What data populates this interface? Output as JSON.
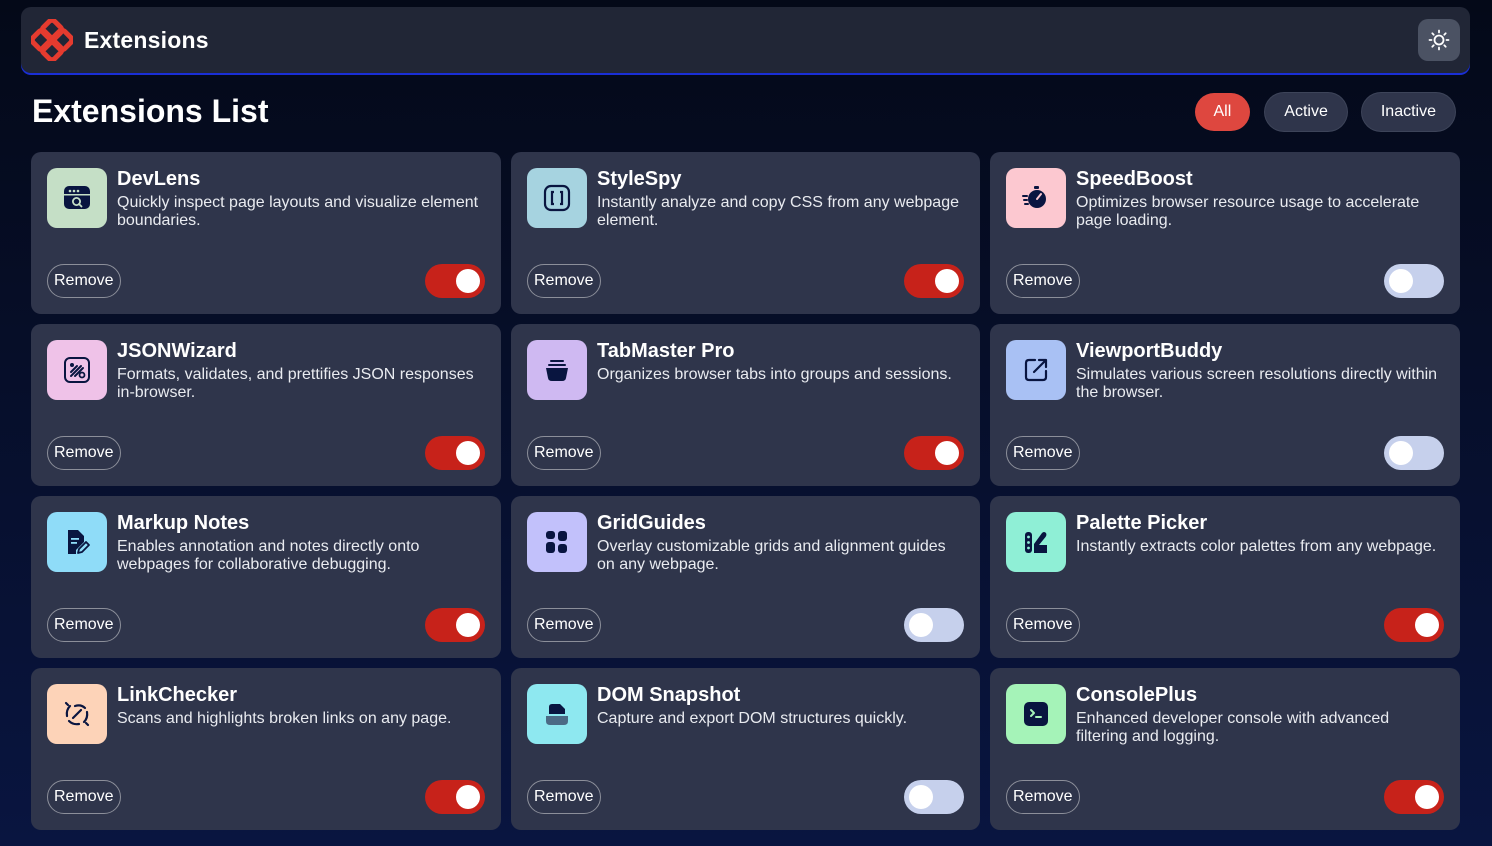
{
  "header": {
    "brand_name": "Extensions",
    "logo_icon": "logo-icon",
    "theme_icon": "sun-icon"
  },
  "page_title": "Extensions List",
  "filters": [
    {
      "label": "All",
      "selected": true
    },
    {
      "label": "Active",
      "selected": false
    },
    {
      "label": "Inactive",
      "selected": false
    }
  ],
  "colors": {
    "accent": "#de473f",
    "toggle_on": "#c7221a",
    "toggle_off": "#c6d0ec",
    "card_bg": "#2f354b",
    "header_bg": "#212636"
  },
  "remove_label": "Remove",
  "extensions": [
    {
      "name": "DevLens",
      "description": "Quickly inspect page layouts and visualize element boundaries.",
      "active": true,
      "icon": "devlens-icon",
      "icon_bg": "#c5dfc6"
    },
    {
      "name": "StyleSpy",
      "description": "Instantly analyze and copy CSS from any webpage element.",
      "active": true,
      "icon": "stylespy-icon",
      "icon_bg": "#a6d3e0"
    },
    {
      "name": "SpeedBoost",
      "description": "Optimizes browser resource usage to accelerate page loading.",
      "active": false,
      "icon": "speedboost-icon",
      "icon_bg": "#fcc8d0"
    },
    {
      "name": "JSONWizard",
      "description": "Formats, validates, and prettifies JSON responses in-browser.",
      "active": true,
      "icon": "jsonwizard-icon",
      "icon_bg": "#efc2e8"
    },
    {
      "name": "TabMaster Pro",
      "description": "Organizes browser tabs into groups and sessions.",
      "active": true,
      "icon": "tabmaster-icon",
      "icon_bg": "#cfb9f2"
    },
    {
      "name": "ViewportBuddy",
      "description": "Simulates various screen resolutions directly within the browser.",
      "active": false,
      "icon": "viewportbuddy-icon",
      "icon_bg": "#a9c1f4"
    },
    {
      "name": "Markup Notes",
      "description": "Enables annotation and notes directly onto webpages for collaborative debugging.",
      "active": true,
      "icon": "markupnotes-icon",
      "icon_bg": "#8fdcf8"
    },
    {
      "name": "GridGuides",
      "description": "Overlay customizable grids and alignment guides on any webpage.",
      "active": false,
      "icon": "gridguides-icon",
      "icon_bg": "#c2c1fb"
    },
    {
      "name": "Palette Picker",
      "description": "Instantly extracts color palettes from any webpage.",
      "active": true,
      "icon": "palettepicker-icon",
      "icon_bg": "#8fefd6"
    },
    {
      "name": "LinkChecker",
      "description": "Scans and highlights broken links on any page.",
      "active": true,
      "icon": "linkchecker-icon",
      "icon_bg": "#fdd3b8"
    },
    {
      "name": "DOM Snapshot",
      "description": "Capture and export DOM structures quickly.",
      "active": false,
      "icon": "domsnapshot-icon",
      "icon_bg": "#8ee8f0"
    },
    {
      "name": "ConsolePlus",
      "description": "Enhanced developer console with advanced filtering and logging.",
      "active": true,
      "icon": "consoleplus-icon",
      "icon_bg": "#a5f3b8"
    }
  ]
}
